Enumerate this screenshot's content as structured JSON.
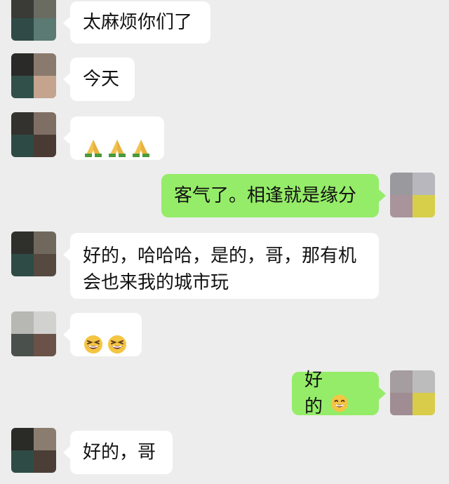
{
  "chat": {
    "messages": [
      {
        "side": "left",
        "text": "太麻烦你们了"
      },
      {
        "side": "left",
        "text": "今天"
      },
      {
        "side": "left",
        "emoji": "folded-hands-emoji",
        "count": 3
      },
      {
        "side": "right",
        "text": "客气了。相逢就是缘分"
      },
      {
        "side": "left",
        "text": "好的，哈哈哈，是的，哥，那有机会也来我的城市玩"
      },
      {
        "side": "left",
        "emoji": "grinning-squinting-emoji",
        "count": 2
      },
      {
        "side": "right",
        "text": "好的",
        "emoji": "smiling-face-emoji",
        "count": 1
      },
      {
        "side": "left",
        "text": "好的，哥"
      }
    ]
  },
  "colors": {
    "background": "#ededed",
    "incoming_bubble": "#ffffff",
    "outgoing_bubble": "#95ec69"
  }
}
